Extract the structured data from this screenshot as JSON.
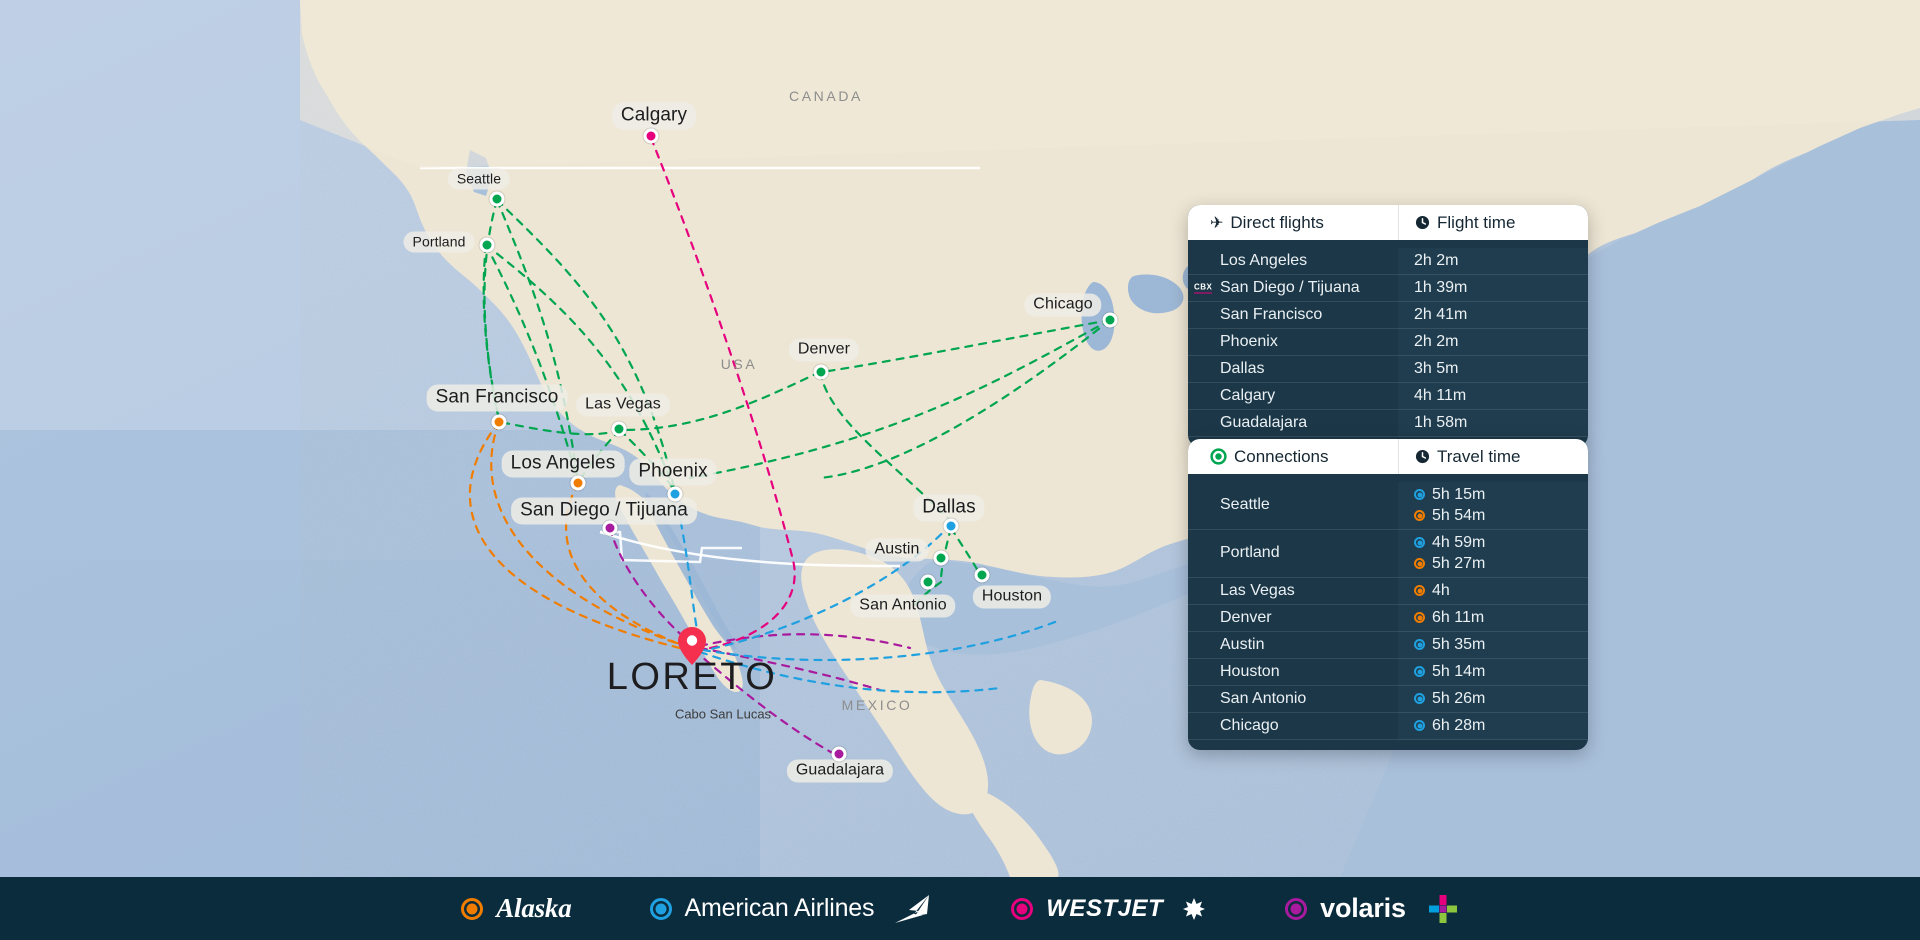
{
  "map": {
    "hub": {
      "name": "LORETO",
      "marker": "location-pin"
    },
    "secondary_label": "Cabo San Lucas",
    "countries": [
      "CANADA",
      "USA",
      "MEXICO"
    ],
    "cities": [
      {
        "name": "Calgary",
        "airline": "WestJet",
        "color": "#e6007e"
      },
      {
        "name": "Seattle",
        "airline": "connection-green",
        "color": "#00a550"
      },
      {
        "name": "Portland",
        "airline": "connection-green",
        "color": "#00a550"
      },
      {
        "name": "San Francisco",
        "airline": "Alaska",
        "color": "#f07d00"
      },
      {
        "name": "Las Vegas",
        "airline": "connection-green",
        "color": "#00a550"
      },
      {
        "name": "Los Angeles",
        "airline": "Alaska",
        "color": "#f07d00"
      },
      {
        "name": "San Diego / Tijuana",
        "airline": "Volaris",
        "color": "#a81a9e"
      },
      {
        "name": "Phoenix",
        "airline": "American Airlines",
        "color": "#1fa0e0"
      },
      {
        "name": "Denver",
        "airline": "connection-green",
        "color": "#00a550"
      },
      {
        "name": "Chicago",
        "airline": "connection-green",
        "color": "#00a550"
      },
      {
        "name": "Dallas",
        "airline": "American Airlines",
        "color": "#1fa0e0"
      },
      {
        "name": "Austin",
        "airline": "connection-green",
        "color": "#00a550"
      },
      {
        "name": "Houston",
        "airline": "connection-green",
        "color": "#00a550"
      },
      {
        "name": "San Antonio",
        "airline": "connection-green",
        "color": "#00a550"
      },
      {
        "name": "Guadalajara",
        "airline": "Volaris",
        "color": "#a81a9e"
      }
    ]
  },
  "direct_panel": {
    "header": {
      "col1": "Direct flights",
      "col2": "Flight time",
      "col1_icon": "airplane-icon",
      "col2_icon": "clock-icon"
    },
    "rows": [
      {
        "city": "Los Angeles",
        "time": "2h 2m",
        "badge": ""
      },
      {
        "city": "San Diego / Tijuana",
        "time": "1h 39m",
        "badge": "CBX"
      },
      {
        "city": "San Francisco",
        "time": "2h 41m",
        "badge": ""
      },
      {
        "city": "Phoenix",
        "time": "2h 2m",
        "badge": ""
      },
      {
        "city": "Dallas",
        "time": "3h 5m",
        "badge": ""
      },
      {
        "city": "Calgary",
        "time": "4h 11m",
        "badge": ""
      },
      {
        "city": "Guadalajara",
        "time": "1h 58m",
        "badge": ""
      }
    ]
  },
  "connections_panel": {
    "header": {
      "col1": "Connections",
      "col2": "Travel time",
      "col1_icon": "green-circle-icon",
      "col2_icon": "clock-icon"
    },
    "rows": [
      {
        "city": "Seattle",
        "times": [
          {
            "time": "5h 15m",
            "color": "#1fa0e0"
          },
          {
            "time": "5h 54m",
            "color": "#f07d00"
          }
        ]
      },
      {
        "city": "Portland",
        "times": [
          {
            "time": "4h 59m",
            "color": "#1fa0e0"
          },
          {
            "time": "5h 27m",
            "color": "#f07d00"
          }
        ]
      },
      {
        "city": "Las Vegas",
        "times": [
          {
            "time": "4h",
            "color": "#f07d00"
          }
        ]
      },
      {
        "city": "Denver",
        "times": [
          {
            "time": "6h 11m",
            "color": "#f07d00"
          }
        ]
      },
      {
        "city": "Austin",
        "times": [
          {
            "time": "5h 35m",
            "color": "#1fa0e0"
          }
        ]
      },
      {
        "city": "Houston",
        "times": [
          {
            "time": "5h 14m",
            "color": "#1fa0e0"
          }
        ]
      },
      {
        "city": "San Antonio",
        "times": [
          {
            "time": "5h 26m",
            "color": "#1fa0e0"
          }
        ]
      },
      {
        "city": "Chicago",
        "times": [
          {
            "time": "6h 28m",
            "color": "#1fa0e0"
          }
        ]
      }
    ]
  },
  "footer": {
    "airlines": [
      {
        "name": "Alaska",
        "color": "#f07d00"
      },
      {
        "name": "American Airlines",
        "color": "#1fa0e0"
      },
      {
        "name": "WESTJET",
        "color": "#e6007e"
      },
      {
        "name": "volaris",
        "color": "#a81a9e"
      }
    ]
  },
  "colors": {
    "alaska": "#f07d00",
    "american": "#1fa0e0",
    "westjet": "#e6007e",
    "volaris": "#a81a9e",
    "connection": "#00a550",
    "panel_bg": "#1c3848",
    "footer_bg": "#0b2c3d",
    "ocean": "#b9cce3",
    "land": "#e8e2d4",
    "hub_pin": "#f5304f"
  }
}
